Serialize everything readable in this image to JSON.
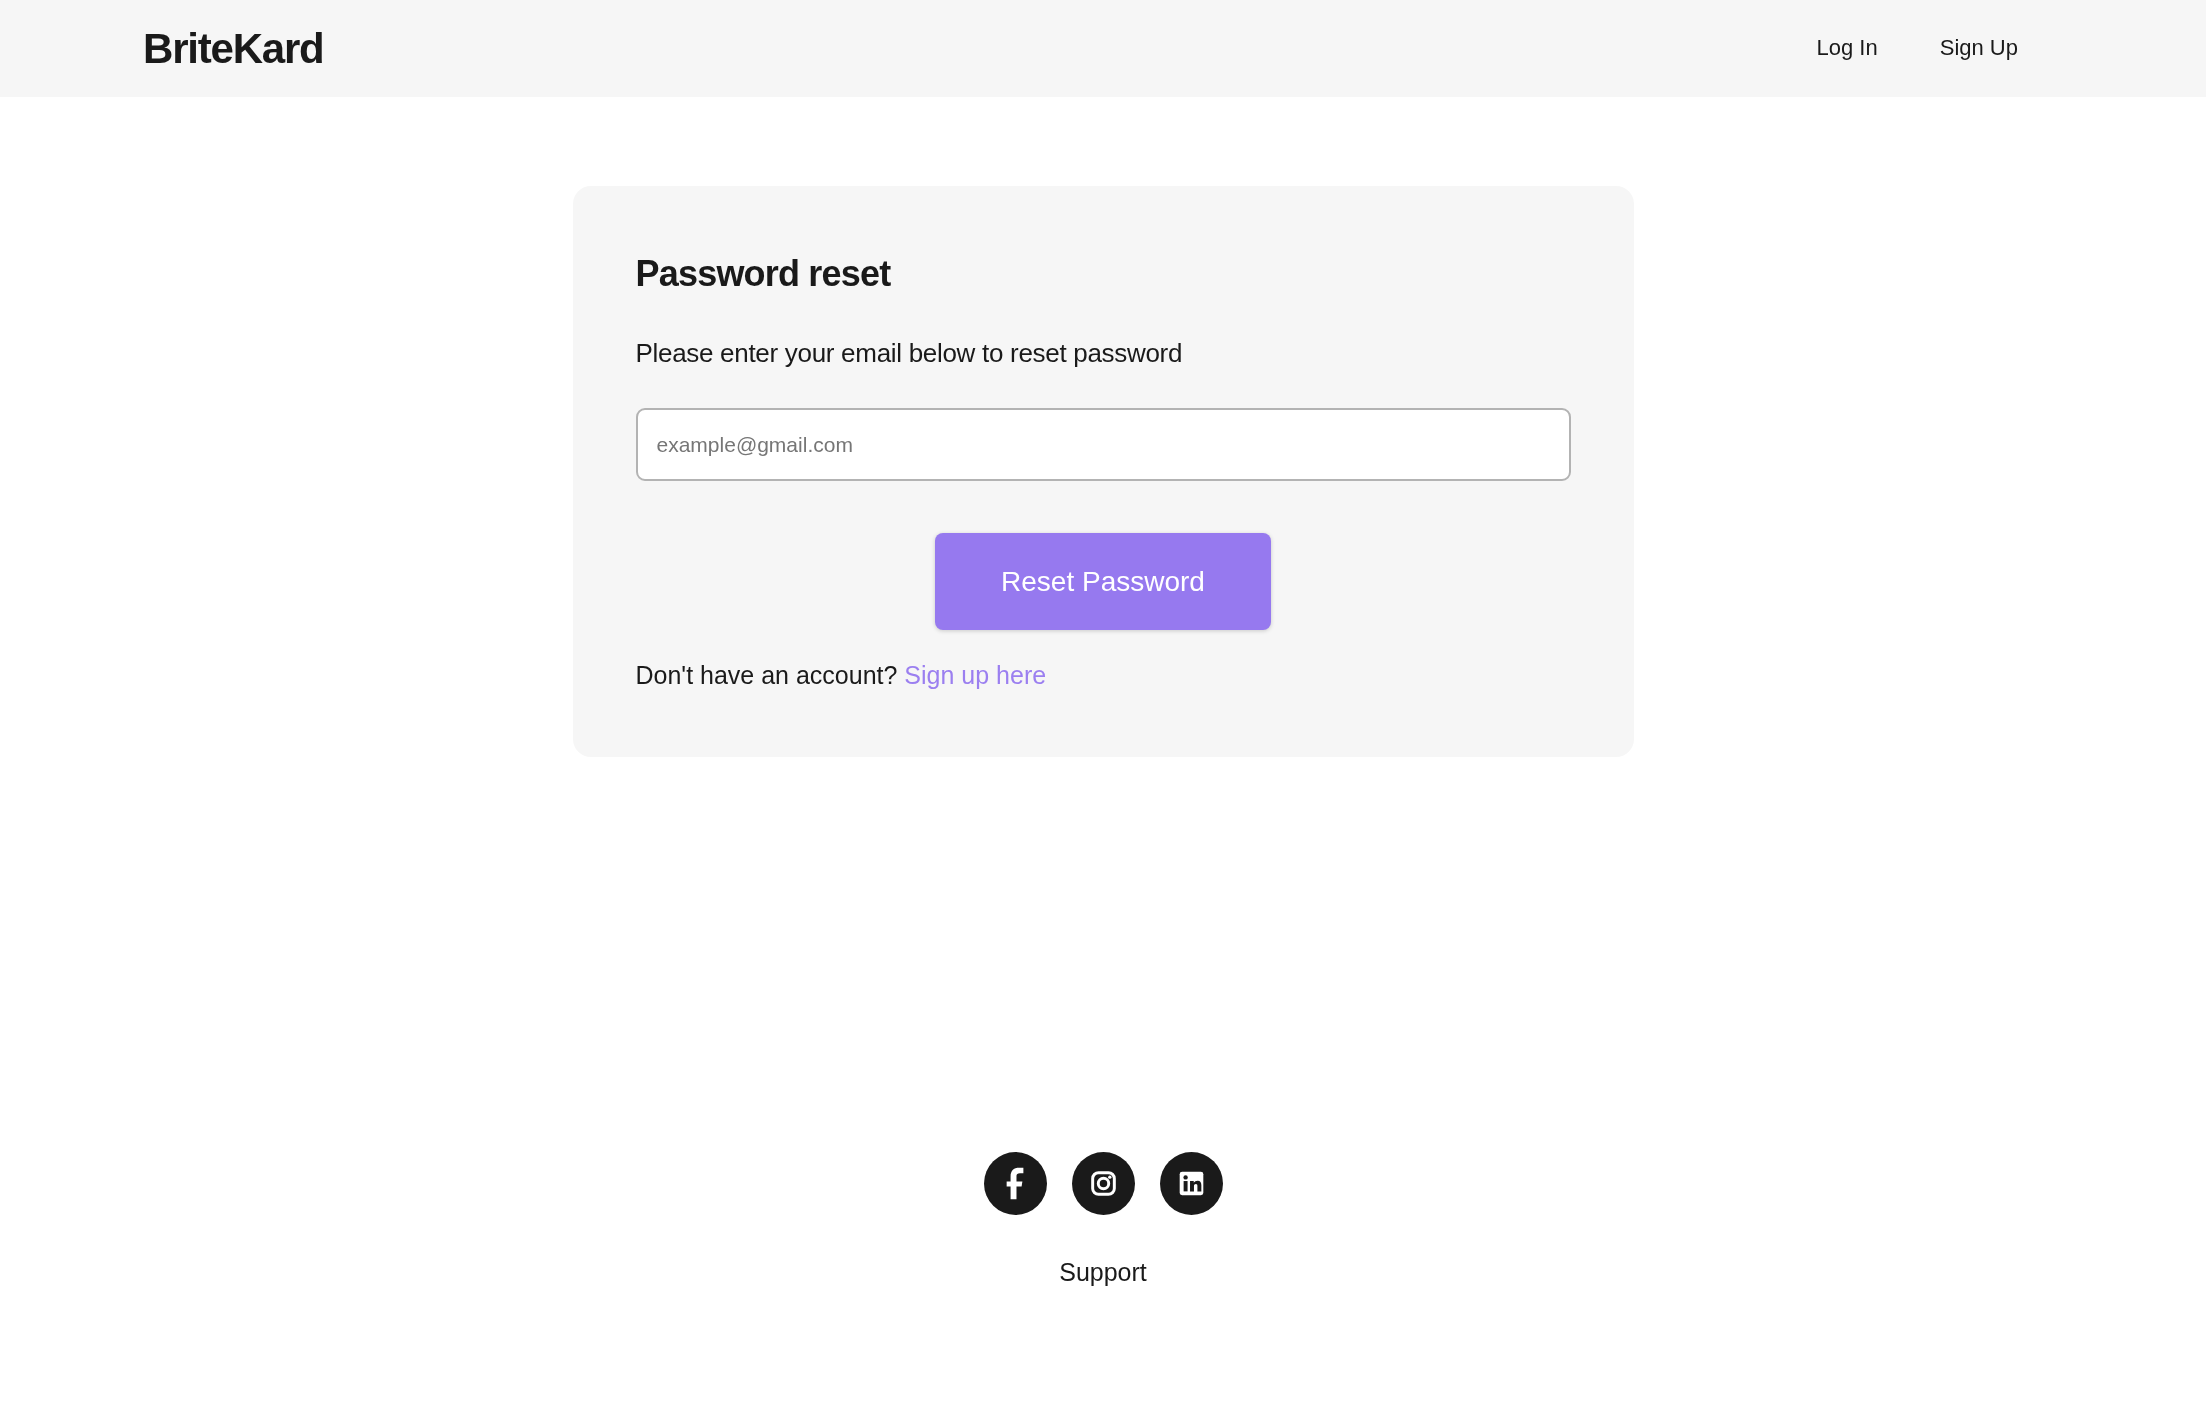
{
  "navbar": {
    "brand": "BriteKard",
    "links": [
      {
        "label": "Log In"
      },
      {
        "label": "Sign Up"
      }
    ]
  },
  "card": {
    "title": "Password reset",
    "instructions": "Please enter your email below to reset password",
    "email_field": {
      "placeholder": "example@gmail.com"
    },
    "button": "Reset Password",
    "signup_prompt": {
      "text": "Don't have an account?",
      "link": "Sign up here"
    }
  },
  "footer": {
    "support_link": "Support"
  }
}
